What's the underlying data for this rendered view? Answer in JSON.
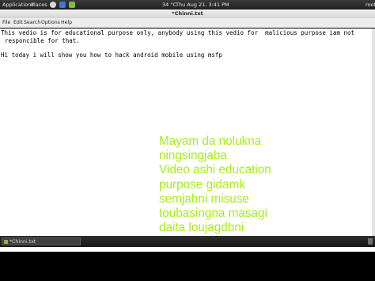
{
  "panel": {
    "applications": "Applications",
    "places": "Places",
    "weather": "34 °C",
    "clock": "Thu Aug 21,  3:41 PM",
    "user": "root"
  },
  "window": {
    "title": "*Chinni.txt"
  },
  "menubar": [
    "File",
    "Edit",
    "Search",
    "Options",
    "Help"
  ],
  "editor": {
    "lines": [
      "This vedio is for educational purpose only, anybody using this vedio for  malicious purpose iam not",
      "responcible for that.",
      "Hi today i will show you how to hack android mobile using msfp"
    ]
  },
  "overlay_caption": [
    "Mayam da nolukna",
    "ningsingjaba",
    "Video ashi education",
    "purpose gidamk",
    "semjabni misuse",
    "toubasingna masagi",
    "daita loujagdbni"
  ],
  "taskbar": {
    "window_label": "*Chinni.txt"
  },
  "colors": {
    "caption": "#a6ee19",
    "panel": "#2a2a2a"
  }
}
